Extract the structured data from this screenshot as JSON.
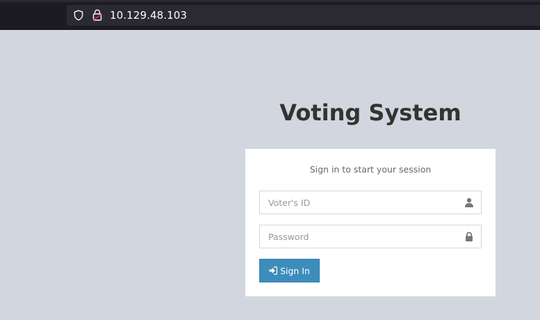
{
  "browser": {
    "url": "10.129.48.103",
    "icons": [
      "shield-icon",
      "lock-icon"
    ]
  },
  "page": {
    "title": "Voting System",
    "login": {
      "message": "Sign in to start your session",
      "voter_id_placeholder": "Voter's ID",
      "password_placeholder": "Password",
      "voter_id_value": "",
      "password_value": "",
      "voter_icon": "user-icon",
      "password_icon": "lock-icon",
      "signin_label": "Sign In",
      "signin_icon": "sign-in-icon"
    }
  },
  "colors": {
    "background": "#d2d6de",
    "button": "#3c8dbc",
    "browser_bar": "#1c1b22",
    "urlbar": "#2b2a33"
  }
}
